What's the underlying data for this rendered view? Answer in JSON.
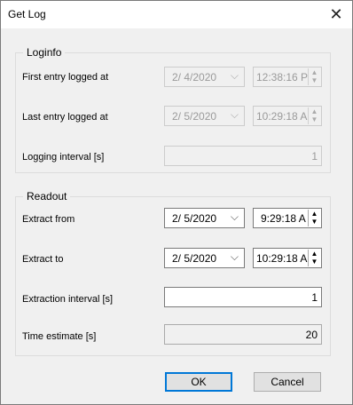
{
  "window": {
    "title": "Get Log"
  },
  "loginfo": {
    "legend": "Loginfo",
    "first_entry": {
      "label": "First entry logged at",
      "date": "2/ 4/2020",
      "time": "12:38:16 P"
    },
    "last_entry": {
      "label": "Last entry logged at",
      "date": "2/ 5/2020",
      "time": "10:29:18 A"
    },
    "interval": {
      "label": "Logging interval [s]",
      "value": "1"
    }
  },
  "readout": {
    "legend": "Readout",
    "extract_from": {
      "label": "Extract from",
      "date": "2/ 5/2020",
      "time": "9:29:18 A"
    },
    "extract_to": {
      "label": "Extract to",
      "date": "2/ 5/2020",
      "time": "10:29:18 A"
    },
    "extraction_interval": {
      "label": "Extraction interval [s]",
      "value": "1"
    },
    "time_estimate": {
      "label": "Time estimate [s]",
      "value": "20"
    }
  },
  "buttons": {
    "ok": "OK",
    "cancel": "Cancel"
  },
  "icons": {
    "close": "close-icon",
    "chevron": "chevron-down-icon",
    "spin": "spin-arrows-icon"
  }
}
